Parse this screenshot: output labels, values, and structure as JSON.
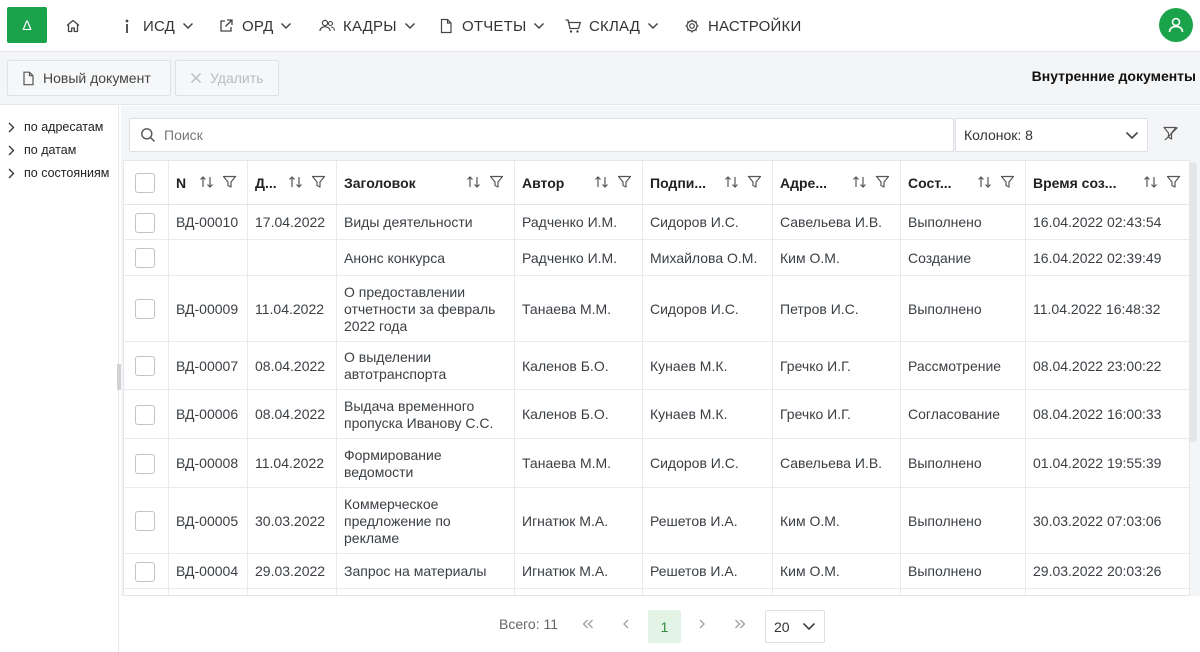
{
  "brand": {
    "logo_glyph": "Δ",
    "accent": "#1aa34a"
  },
  "nav": {
    "isd": "ИСД",
    "ord": "ОРД",
    "kadry": "КАДРЫ",
    "otchety": "ОТЧЕТЫ",
    "sklad": "СКЛАД",
    "nastroiki": "НАСТРОЙКИ"
  },
  "toolbar": {
    "new_doc": "Новый документ",
    "delete": "Удалить",
    "title": "Внутренние документы"
  },
  "tree": [
    "по адресатам",
    "по датам",
    "по состояниям"
  ],
  "search": {
    "placeholder": "Поиск"
  },
  "columns_select": "Колонок: 8",
  "headers": {
    "num": "N",
    "date": "Д...",
    "subject": "Заголовок",
    "author": "Автор",
    "signer": "Подпи...",
    "addressee": "Адре...",
    "state": "Сост...",
    "created": "Время соз..."
  },
  "rows": [
    {
      "num": "ВД-00010",
      "date": "17.04.2022",
      "subject": "Виды деятельности",
      "author": "Радченко И.М.",
      "signer": "Сидоров И.С.",
      "addressee": "Савельева И.В.",
      "state": "Выполнено",
      "created": "16.04.2022 02:43:54"
    },
    {
      "num": "",
      "date": "",
      "subject": "Анонс конкурса",
      "author": "Радченко И.М.",
      "signer": "Михайлова О.М.",
      "addressee": "Ким О.М.",
      "state": "Создание",
      "created": "16.04.2022 02:39:49"
    },
    {
      "num": "ВД-00009",
      "date": "11.04.2022",
      "subject": "О предоставлении отчетности за февраль 2022 года",
      "author": "Танаева М.М.",
      "signer": "Сидоров И.С.",
      "addressee": "Петров И.С.",
      "state": "Выполнено",
      "created": "11.04.2022 16:48:32"
    },
    {
      "num": "ВД-00007",
      "date": "08.04.2022",
      "subject": "О выделении автотранспорта",
      "author": "Каленов Б.О.",
      "signer": "Кунаев М.К.",
      "addressee": "Гречко И.Г.",
      "state": "Рассмотрение",
      "created": "08.04.2022 23:00:22"
    },
    {
      "num": "ВД-00006",
      "date": "08.04.2022",
      "subject": "Выдача временного пропуска Иванову С.С.",
      "author": "Каленов Б.О.",
      "signer": "Кунаев М.К.",
      "addressee": "Гречко И.Г.",
      "state": "Согласование",
      "created": "08.04.2022 16:00:33"
    },
    {
      "num": "ВД-00008",
      "date": "11.04.2022",
      "subject": "Формирование ведомости",
      "author": "Танаева М.М.",
      "signer": "Сидоров И.С.",
      "addressee": "Савельева И.В.",
      "state": "Выполнено",
      "created": "01.04.2022 19:55:39"
    },
    {
      "num": "ВД-00005",
      "date": "30.03.2022",
      "subject": "Коммерческое предложение по рекламе",
      "author": "Игнатюк М.А.",
      "signer": "Решетов И.А.",
      "addressee": "Ким О.М.",
      "state": "Выполнено",
      "created": "30.03.2022 07:03:06"
    },
    {
      "num": "ВД-00004",
      "date": "29.03.2022",
      "subject": "Запрос на материалы",
      "author": "Игнатюк М.А.",
      "signer": "Решетов И.А.",
      "addressee": "Ким О.М.",
      "state": "Выполнено",
      "created": "29.03.2022 20:03:26"
    }
  ],
  "pager": {
    "total": "Всего: 11",
    "current": "1",
    "page_size": "20"
  }
}
